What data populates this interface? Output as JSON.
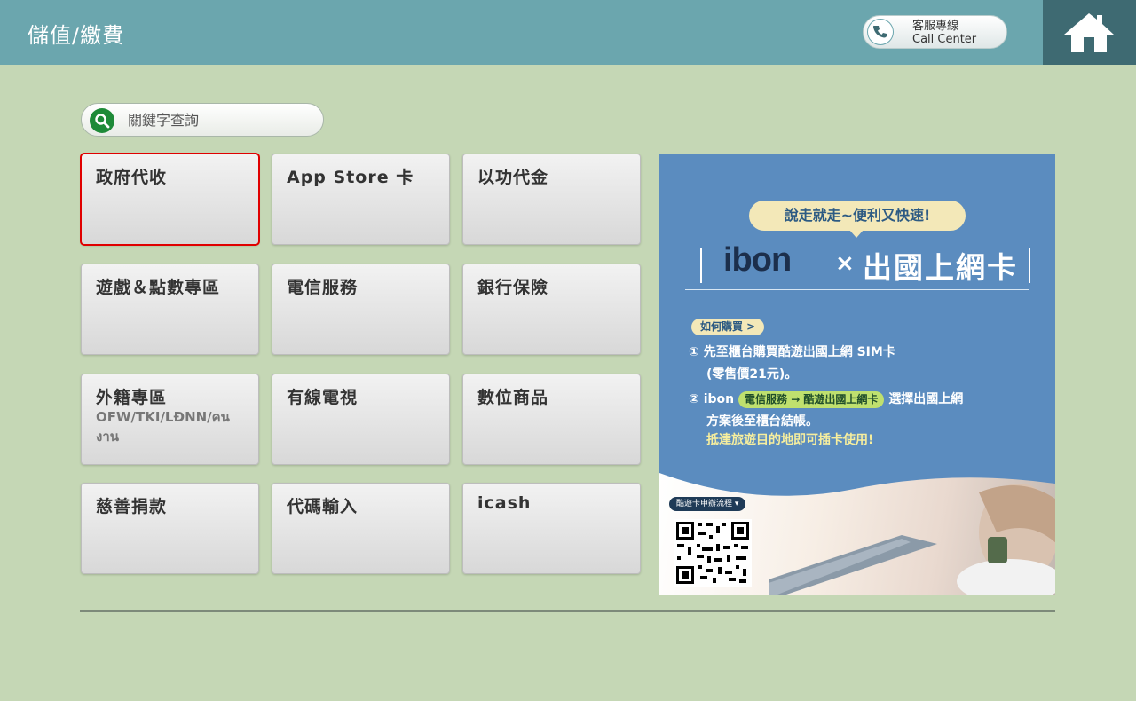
{
  "header": {
    "title": "儲值/繳費",
    "call_center_cn": "客服專線",
    "call_center_en": "Call Center"
  },
  "search": {
    "placeholder": "關鍵字查詢"
  },
  "tiles": [
    {
      "label": "政府代收",
      "selected": true
    },
    {
      "label": "App Store 卡"
    },
    {
      "label": "以功代金"
    },
    {
      "label": "遊戲＆點數專區"
    },
    {
      "label": "電信服務"
    },
    {
      "label": "銀行保險"
    },
    {
      "label": "外籍專區",
      "sub": "OFW/TKI/LĐNN/คนงาน"
    },
    {
      "label": "有線電視"
    },
    {
      "label": "數位商品"
    },
    {
      "label": "慈善捐款"
    },
    {
      "label": "代碼輸入"
    },
    {
      "label": "icash"
    }
  ],
  "banner": {
    "bubble": "說走就走~便利又快速!",
    "logo": "ibon",
    "x": "×",
    "title": "出國上網卡",
    "how_tag": "如何購買 >",
    "step1_line1": "① 先至櫃台購買酷遊出國上網 SIM卡",
    "step1_line2": "(零售價21元)。",
    "step2_prefix": "② ibon",
    "step2_pill": "電信服務 → 酷遊出國上網卡",
    "step2_suffix": "選擇出國上網",
    "step2_line2": "方案後至櫃台結帳。",
    "step3": "抵達旅遊目的地即可插卡使用!",
    "qr_tag": "酷遊卡申辦流程 ▾"
  }
}
